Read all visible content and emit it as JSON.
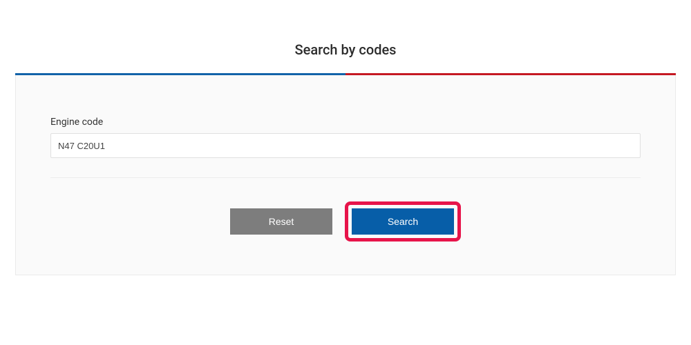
{
  "title": "Search by codes",
  "form": {
    "engineCode": {
      "label": "Engine code",
      "value": "N47 C20U1"
    }
  },
  "buttons": {
    "reset": "Reset",
    "search": "Search"
  }
}
